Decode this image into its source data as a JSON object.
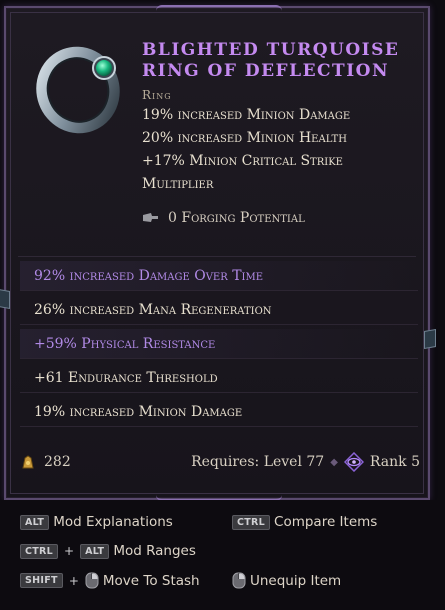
{
  "item": {
    "title_line1": "Blighted Turquoise",
    "title_line2": "Ring of Deflection",
    "type": "Ring",
    "icon": "ring-icon"
  },
  "implicits": [
    "19% increased Minion Damage",
    "20% increased Minion Health",
    "+17% Minion Critical Strike",
    "Multiplier"
  ],
  "forging": {
    "icon": "hammer-icon",
    "text": "0 Forging Potential"
  },
  "mods": [
    {
      "text": "92% increased Damage Over Time",
      "color": "#b18ae6"
    },
    {
      "text": "26% increased Mana Regeneration",
      "color": "#e8e0cf"
    },
    {
      "text": "+59% Physical Resistance",
      "color": "#b18ae6"
    },
    {
      "text": "+61 Endurance Threshold",
      "color": "#e8e0cf"
    },
    {
      "text": "19% increased Minion Damage",
      "color": "#e8e0cf"
    }
  ],
  "footer": {
    "gold_icon": "gold-coin-icon",
    "gold_value": "282",
    "requires_label": "Requires: Level 77",
    "rank_icon": "rank-eye-icon",
    "rank_label": "Rank 5"
  },
  "hints": {
    "alt_key": "ALT",
    "ctrl_key": "CTRL",
    "shift_key": "SHIFT",
    "mod_explanations": "Mod Explanations",
    "compare_items": "Compare Items",
    "mod_ranges": "Mod Ranges",
    "move_to_stash": "Move To Stash",
    "unequip_item": "Unequip Item",
    "plus": "+"
  },
  "colors": {
    "title": "#c48af0",
    "affix_magic": "#b18ae6",
    "text": "#e8e0cf",
    "frame": "#5a4a6e"
  }
}
